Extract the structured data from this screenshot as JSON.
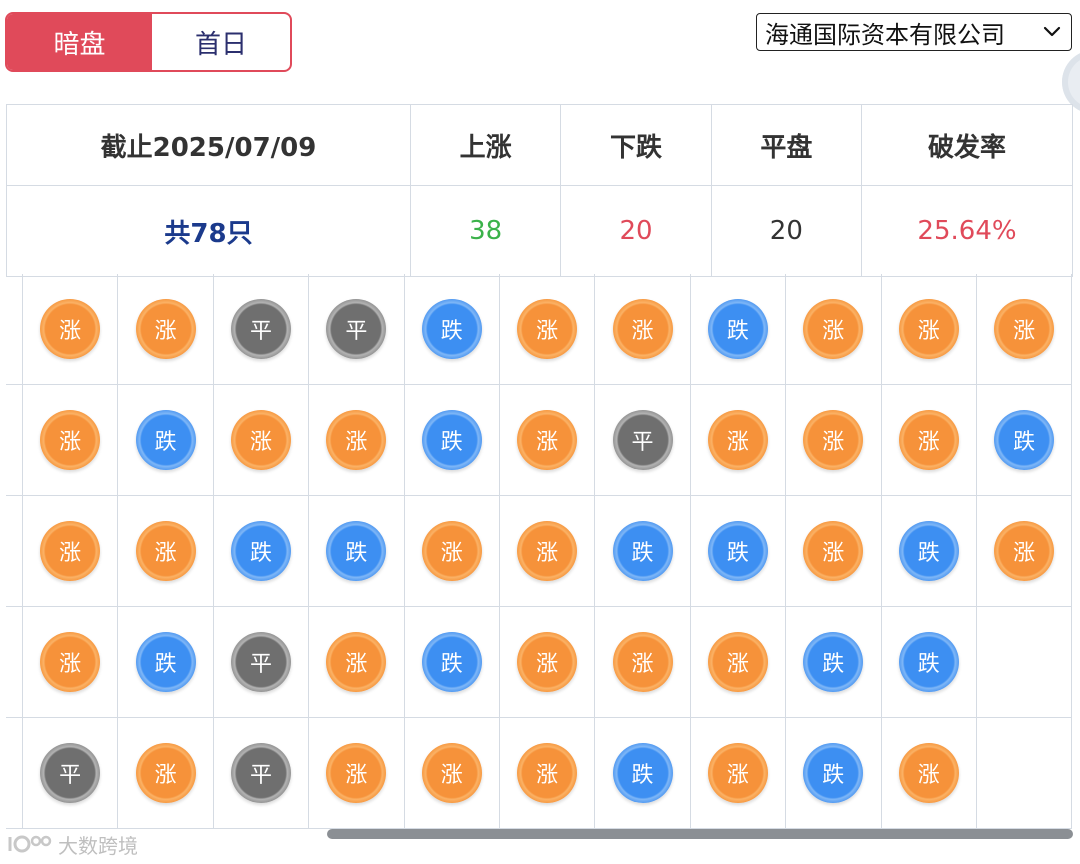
{
  "tabs": [
    {
      "label": "暗盘",
      "active": true
    },
    {
      "label": "首日",
      "active": false
    }
  ],
  "broker_select": {
    "selected": "海通国际资本有限公司"
  },
  "summary": {
    "headers": [
      "截止2025/07/09",
      "上涨",
      "下跌",
      "平盘",
      "破发率"
    ],
    "total": "共78只",
    "rise": "38",
    "fall": "20",
    "flat": "20",
    "break_rate": "25.64%"
  },
  "grid": {
    "labels": {
      "up": "涨",
      "down": "跌",
      "flat": "平"
    },
    "rows": [
      [
        "up",
        "up",
        "flat",
        "flat",
        "down",
        "up",
        "up",
        "down",
        "up",
        "up",
        "up"
      ],
      [
        "up",
        "down",
        "up",
        "up",
        "down",
        "up",
        "flat",
        "up",
        "up",
        "up",
        "down"
      ],
      [
        "up",
        "up",
        "down",
        "down",
        "up",
        "up",
        "down",
        "down",
        "up",
        "down",
        "up"
      ],
      [
        "up",
        "down",
        "flat",
        "up",
        "down",
        "up",
        "up",
        "up",
        "down",
        "down",
        ""
      ],
      [
        "flat",
        "up",
        "flat",
        "up",
        "up",
        "up",
        "down",
        "up",
        "down",
        "up",
        ""
      ]
    ]
  },
  "watermark": {
    "text": "大数跨境"
  },
  "colors": {
    "accent_red": "#e04a5a",
    "rise_green": "#3bb24a",
    "navy": "#1b3a8c",
    "coin_up": "#f6923a",
    "coin_down": "#3d8ff2",
    "coin_flat": "#6f6f6f"
  }
}
